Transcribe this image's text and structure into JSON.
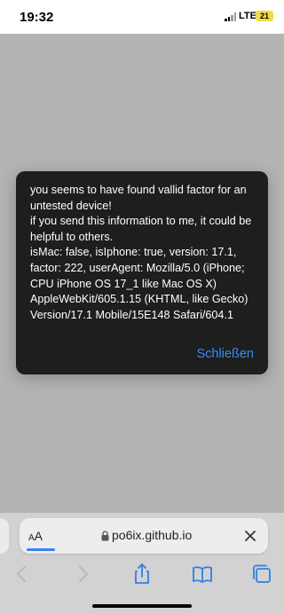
{
  "status_bar": {
    "time": "19:32",
    "network": "LTE",
    "battery": "21",
    "battery_color": "#f2d94a"
  },
  "dialog": {
    "message": "you seems to have found vallid factor for an untested device!\nif you send this information to me, it could be helpful to others.\nisMac: false, isIphone: true, version: 17.1, factor: 222, userAgent: Mozilla/5.0 (iPhone; CPU iPhone OS 17_1 like Mac OS X) AppleWebKit/605.1.15 (KHTML, like Gecko) Version/17.1 Mobile/15E148 Safari/604.1",
    "close_label": "Schließen",
    "accent_color": "#3b8cf0"
  },
  "toolbar": {
    "aa_small": "A",
    "aa_large": "A",
    "url": "po6ix.github.io",
    "icons": [
      "lock-icon",
      "clear-icon",
      "back-icon",
      "forward-icon",
      "share-icon",
      "bookmarks-icon",
      "tabs-icon"
    ]
  }
}
